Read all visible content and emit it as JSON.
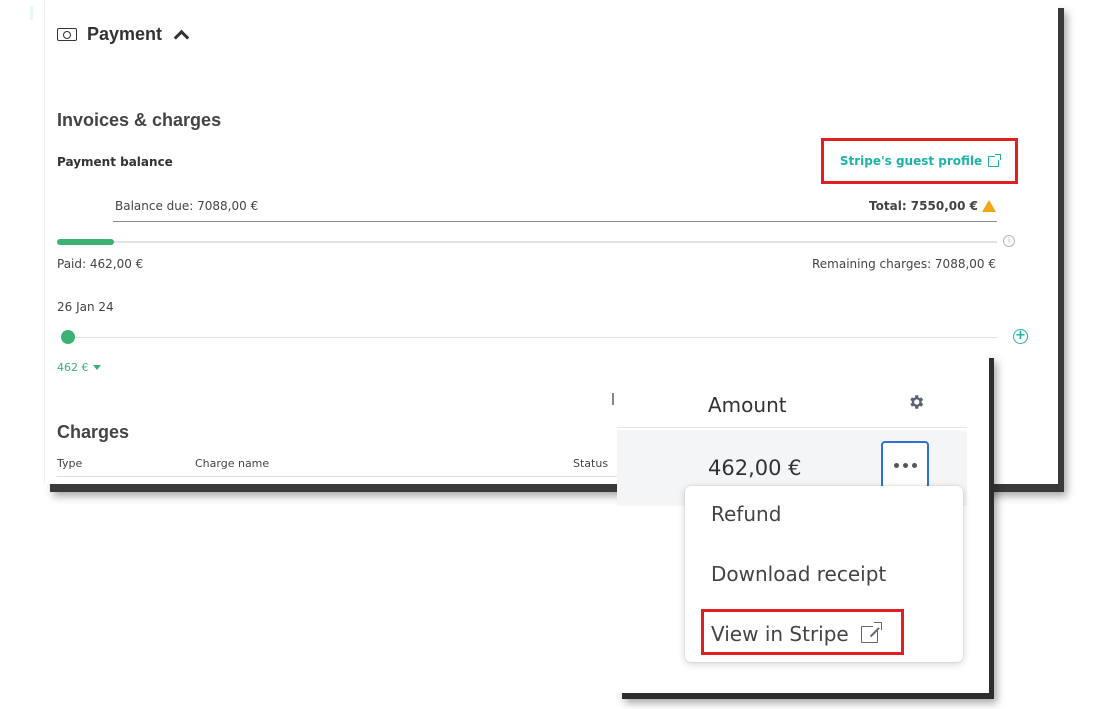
{
  "payment": {
    "title": "Payment",
    "section_title": "Invoices & charges",
    "balance_label": "Payment balance",
    "stripe_guest_link": "Stripe's guest profile",
    "balance_due": "Balance due: 7088,00 €",
    "total": "Total: 7550,00 €",
    "paid": "Paid: 462,00 €",
    "remaining": "Remaining charges: 7088,00 €",
    "paid_progress_percent": 6.1,
    "timeline_date": "26 Jan 24",
    "timeline_amount": "462 €",
    "info_glyph": "i",
    "add_glyph": "+"
  },
  "charges": {
    "title": "Charges",
    "columns": {
      "type": "Type",
      "name": "Charge name",
      "status": "Status"
    }
  },
  "zoom": {
    "amount_header": "Amount",
    "amount_value": "462,00 €",
    "menu": {
      "refund": "Refund",
      "download": "Download receipt",
      "view_stripe": "View in Stripe"
    }
  },
  "colors": {
    "accent_teal": "#1fb3a8",
    "progress_green": "#3bb273",
    "warning": "#f2a516",
    "highlight_red": "#e02020",
    "focus_blue": "#2f6fdc"
  },
  "icons": [
    "money-icon",
    "chevron-up-icon",
    "external-link-icon",
    "warning-icon",
    "info-icon",
    "add-icon",
    "caret-down-icon",
    "gear-icon",
    "more-icon"
  ]
}
